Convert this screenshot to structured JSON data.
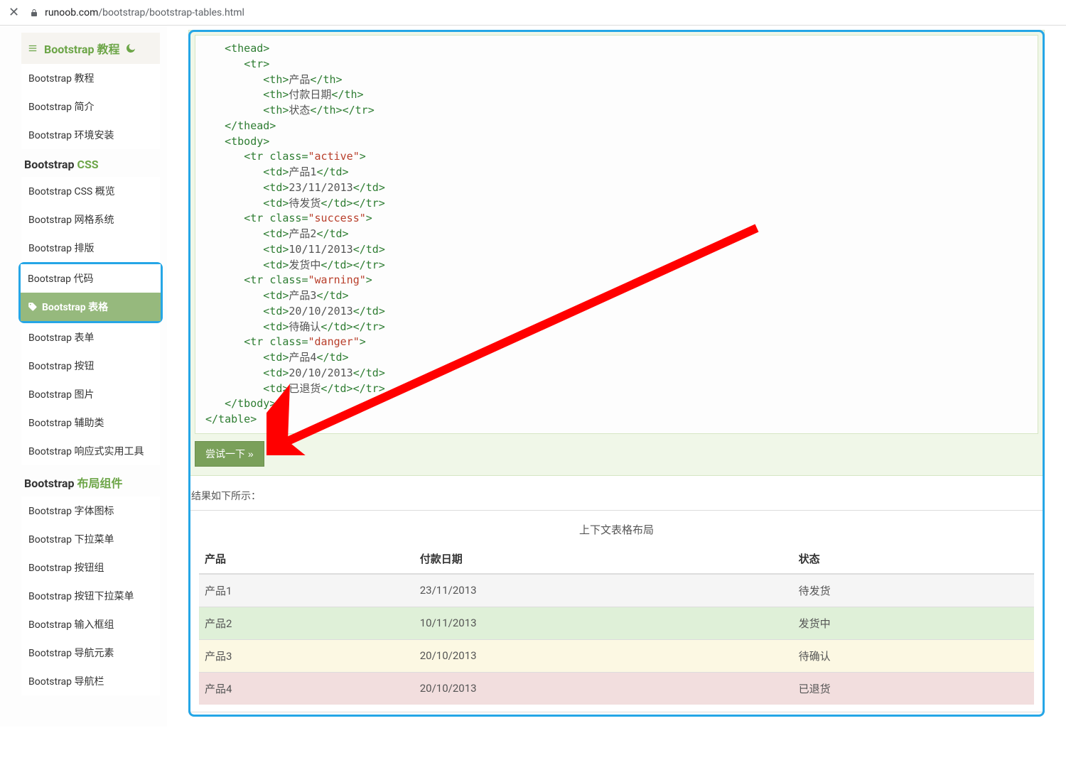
{
  "url": {
    "host": "runoob.com",
    "path": "/bootstrap/bootstrap-tables.html"
  },
  "sidebar": {
    "header": "Bootstrap 教程",
    "sections": [
      {
        "title_plain": "Bootstrap",
        "title_green": "",
        "is_header": true,
        "items": [
          {
            "label": "Bootstrap 教程"
          },
          {
            "label": "Bootstrap 简介"
          },
          {
            "label": "Bootstrap 环境安装"
          }
        ]
      },
      {
        "title_plain": "Bootstrap ",
        "title_green": "CSS",
        "items": [
          {
            "label": "Bootstrap CSS 概览"
          },
          {
            "label": "Bootstrap 网格系统"
          },
          {
            "label": "Bootstrap 排版"
          },
          {
            "label": "Bootstrap 代码"
          },
          {
            "label": "Bootstrap 表格",
            "active": true
          },
          {
            "label": "Bootstrap 表单"
          },
          {
            "label": "Bootstrap 按钮"
          },
          {
            "label": "Bootstrap 图片"
          },
          {
            "label": "Bootstrap 辅助类"
          },
          {
            "label": "Bootstrap 响应式实用工具"
          }
        ]
      },
      {
        "title_plain": "Bootstrap ",
        "title_green": "布局组件",
        "items": [
          {
            "label": "Bootstrap 字体图标"
          },
          {
            "label": "Bootstrap 下拉菜单"
          },
          {
            "label": "Bootstrap 按钮组"
          },
          {
            "label": "Bootstrap 按钮下拉菜单"
          },
          {
            "label": "Bootstrap 输入框组"
          },
          {
            "label": "Bootstrap 导航元素"
          },
          {
            "label": "Bootstrap 导航栏"
          }
        ]
      }
    ]
  },
  "code_data": {
    "rows": [
      {
        "cls": "active",
        "c0": "产品1",
        "c1": "23/11/2013",
        "c2": "待发货"
      },
      {
        "cls": "success",
        "c0": "产品2",
        "c1": "10/11/2013",
        "c2": "发货中"
      },
      {
        "cls": "warning",
        "c0": "产品3",
        "c1": "20/10/2013",
        "c2": "待确认"
      },
      {
        "cls": "danger",
        "c0": "产品4",
        "c1": "20/10/2013",
        "c2": "已退货"
      }
    ],
    "th0": "产品",
    "th1": "付款日期",
    "th2": "状态"
  },
  "try_button": "尝试一下 »",
  "result_label": "结果如下所示：",
  "table": {
    "caption": "上下文表格布局",
    "headers": [
      "产品",
      "付款日期",
      "状态"
    ],
    "rows": [
      {
        "cls": "active",
        "cells": [
          "产品1",
          "23/11/2013",
          "待发货"
        ]
      },
      {
        "cls": "success",
        "cells": [
          "产品2",
          "10/11/2013",
          "发货中"
        ]
      },
      {
        "cls": "warning",
        "cells": [
          "产品3",
          "20/10/2013",
          "待确认"
        ]
      },
      {
        "cls": "danger",
        "cells": [
          "产品4",
          "20/10/2013",
          "已退货"
        ]
      }
    ]
  }
}
